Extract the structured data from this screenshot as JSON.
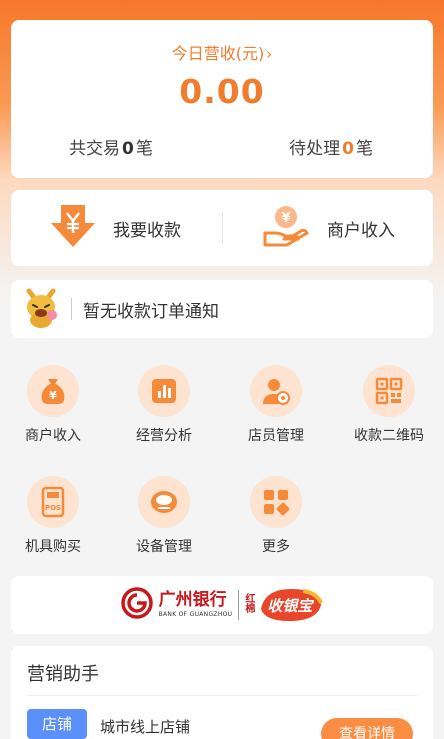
{
  "colors": {
    "brand": "#f07d2e",
    "accent_light": "#fde3d0",
    "bank_red": "#c6191d",
    "tag_blue": "#5b8ff9"
  },
  "income": {
    "title": "今日营收(元)",
    "chevron": "›",
    "amount": "0.00",
    "total_label_prefix": "共交易",
    "total_count": "0",
    "total_label_suffix": "笔",
    "pending_label_prefix": "待处理",
    "pending_count": "0",
    "pending_label_suffix": "笔"
  },
  "actions": [
    {
      "label": "我要收款",
      "icon": "download-yen-icon"
    },
    {
      "label": "商户收入",
      "icon": "hand-coin-icon"
    }
  ],
  "notice": {
    "text": "暂无收款订单通知",
    "icon": "mascot-icon"
  },
  "grid": [
    {
      "label": "商户收入",
      "icon": "money-bag-icon"
    },
    {
      "label": "经营分析",
      "icon": "bar-chart-icon"
    },
    {
      "label": "店员管理",
      "icon": "staff-icon"
    },
    {
      "label": "收款二维码",
      "icon": "qr-code-icon"
    },
    {
      "label": "机具购买",
      "icon": "pos-terminal-icon"
    },
    {
      "label": "设备管理",
      "icon": "device-icon"
    },
    {
      "label": "更多",
      "icon": "more-grid-icon"
    }
  ],
  "bank": {
    "name": "广州银行",
    "name_en": "BANK OF GUANGZHOU",
    "sub_brand_small": "红棉",
    "sub_brand": "收银宝"
  },
  "marketing": {
    "title": "营销助手",
    "tag": "店铺",
    "item": "城市线上店铺",
    "button": "查看详情"
  }
}
